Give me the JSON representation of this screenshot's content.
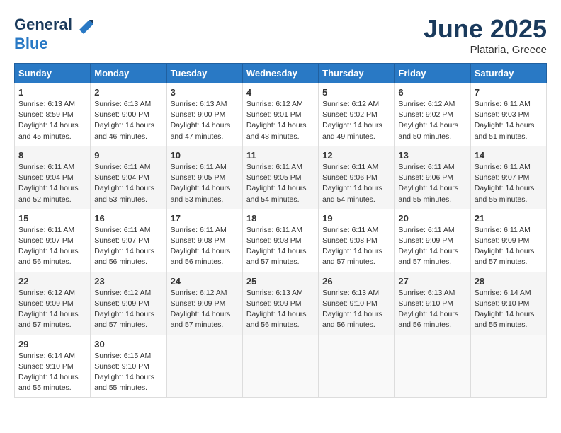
{
  "header": {
    "logo_line1": "General",
    "logo_line2": "Blue",
    "month_title": "June 2025",
    "location": "Plataria, Greece"
  },
  "weekdays": [
    "Sunday",
    "Monday",
    "Tuesday",
    "Wednesday",
    "Thursday",
    "Friday",
    "Saturday"
  ],
  "weeks": [
    [
      {
        "day": "1",
        "sunrise": "6:13 AM",
        "sunset": "8:59 PM",
        "daylight": "14 hours and 45 minutes."
      },
      {
        "day": "2",
        "sunrise": "6:13 AM",
        "sunset": "9:00 PM",
        "daylight": "14 hours and 46 minutes."
      },
      {
        "day": "3",
        "sunrise": "6:13 AM",
        "sunset": "9:00 PM",
        "daylight": "14 hours and 47 minutes."
      },
      {
        "day": "4",
        "sunrise": "6:12 AM",
        "sunset": "9:01 PM",
        "daylight": "14 hours and 48 minutes."
      },
      {
        "day": "5",
        "sunrise": "6:12 AM",
        "sunset": "9:02 PM",
        "daylight": "14 hours and 49 minutes."
      },
      {
        "day": "6",
        "sunrise": "6:12 AM",
        "sunset": "9:02 PM",
        "daylight": "14 hours and 50 minutes."
      },
      {
        "day": "7",
        "sunrise": "6:11 AM",
        "sunset": "9:03 PM",
        "daylight": "14 hours and 51 minutes."
      }
    ],
    [
      {
        "day": "8",
        "sunrise": "6:11 AM",
        "sunset": "9:04 PM",
        "daylight": "14 hours and 52 minutes."
      },
      {
        "day": "9",
        "sunrise": "6:11 AM",
        "sunset": "9:04 PM",
        "daylight": "14 hours and 53 minutes."
      },
      {
        "day": "10",
        "sunrise": "6:11 AM",
        "sunset": "9:05 PM",
        "daylight": "14 hours and 53 minutes."
      },
      {
        "day": "11",
        "sunrise": "6:11 AM",
        "sunset": "9:05 PM",
        "daylight": "14 hours and 54 minutes."
      },
      {
        "day": "12",
        "sunrise": "6:11 AM",
        "sunset": "9:06 PM",
        "daylight": "14 hours and 54 minutes."
      },
      {
        "day": "13",
        "sunrise": "6:11 AM",
        "sunset": "9:06 PM",
        "daylight": "14 hours and 55 minutes."
      },
      {
        "day": "14",
        "sunrise": "6:11 AM",
        "sunset": "9:07 PM",
        "daylight": "14 hours and 55 minutes."
      }
    ],
    [
      {
        "day": "15",
        "sunrise": "6:11 AM",
        "sunset": "9:07 PM",
        "daylight": "14 hours and 56 minutes."
      },
      {
        "day": "16",
        "sunrise": "6:11 AM",
        "sunset": "9:07 PM",
        "daylight": "14 hours and 56 minutes."
      },
      {
        "day": "17",
        "sunrise": "6:11 AM",
        "sunset": "9:08 PM",
        "daylight": "14 hours and 56 minutes."
      },
      {
        "day": "18",
        "sunrise": "6:11 AM",
        "sunset": "9:08 PM",
        "daylight": "14 hours and 57 minutes."
      },
      {
        "day": "19",
        "sunrise": "6:11 AM",
        "sunset": "9:08 PM",
        "daylight": "14 hours and 57 minutes."
      },
      {
        "day": "20",
        "sunrise": "6:11 AM",
        "sunset": "9:09 PM",
        "daylight": "14 hours and 57 minutes."
      },
      {
        "day": "21",
        "sunrise": "6:11 AM",
        "sunset": "9:09 PM",
        "daylight": "14 hours and 57 minutes."
      }
    ],
    [
      {
        "day": "22",
        "sunrise": "6:12 AM",
        "sunset": "9:09 PM",
        "daylight": "14 hours and 57 minutes."
      },
      {
        "day": "23",
        "sunrise": "6:12 AM",
        "sunset": "9:09 PM",
        "daylight": "14 hours and 57 minutes."
      },
      {
        "day": "24",
        "sunrise": "6:12 AM",
        "sunset": "9:09 PM",
        "daylight": "14 hours and 57 minutes."
      },
      {
        "day": "25",
        "sunrise": "6:13 AM",
        "sunset": "9:09 PM",
        "daylight": "14 hours and 56 minutes."
      },
      {
        "day": "26",
        "sunrise": "6:13 AM",
        "sunset": "9:10 PM",
        "daylight": "14 hours and 56 minutes."
      },
      {
        "day": "27",
        "sunrise": "6:13 AM",
        "sunset": "9:10 PM",
        "daylight": "14 hours and 56 minutes."
      },
      {
        "day": "28",
        "sunrise": "6:14 AM",
        "sunset": "9:10 PM",
        "daylight": "14 hours and 55 minutes."
      }
    ],
    [
      {
        "day": "29",
        "sunrise": "6:14 AM",
        "sunset": "9:10 PM",
        "daylight": "14 hours and 55 minutes."
      },
      {
        "day": "30",
        "sunrise": "6:15 AM",
        "sunset": "9:10 PM",
        "daylight": "14 hours and 55 minutes."
      },
      null,
      null,
      null,
      null,
      null
    ]
  ]
}
